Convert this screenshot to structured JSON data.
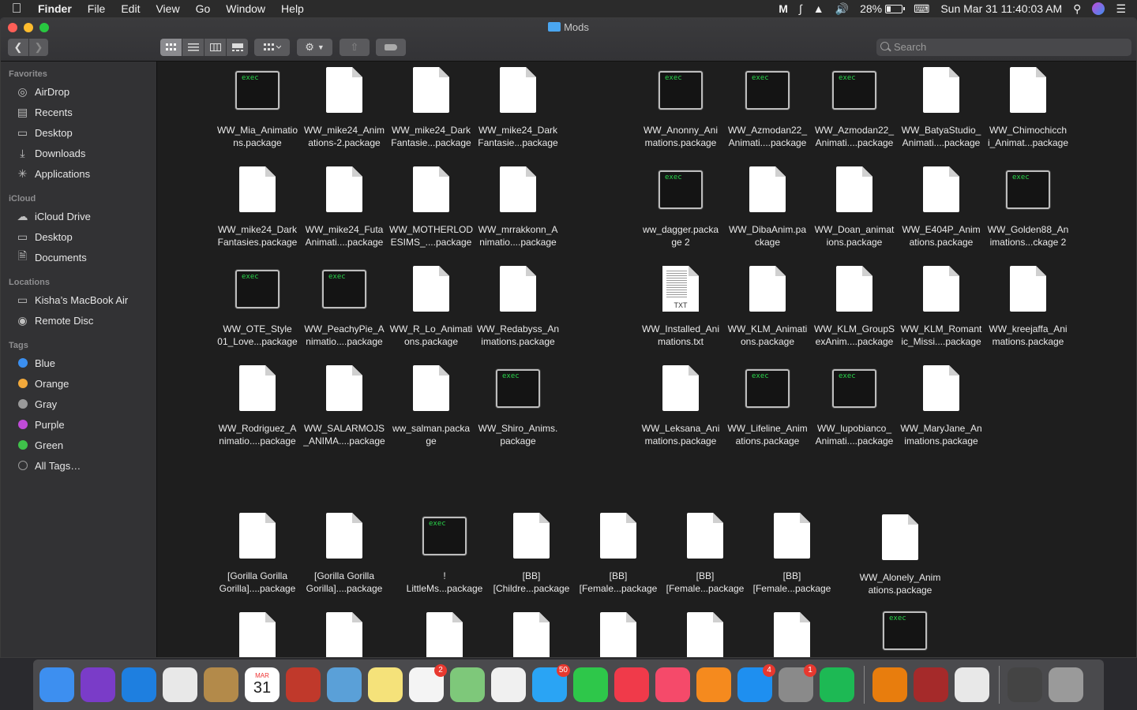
{
  "menubar": {
    "app_name": "Finder",
    "menus": [
      "File",
      "Edit",
      "View",
      "Go",
      "Window",
      "Help"
    ],
    "battery": "28%",
    "datetime": "Sun Mar 31  11:40:03 AM"
  },
  "window": {
    "title": "Mods",
    "search_placeholder": "Search"
  },
  "sidebar": {
    "favorites_header": "Favorites",
    "favorites": [
      "AirDrop",
      "Recents",
      "Desktop",
      "Downloads",
      "Applications"
    ],
    "icloud_header": "iCloud",
    "icloud": [
      "iCloud Drive",
      "Desktop",
      "Documents"
    ],
    "locations_header": "Locations",
    "locations": [
      "Kisha’s MacBook Air",
      "Remote Disc"
    ],
    "tags_header": "Tags",
    "tags": [
      {
        "label": "Blue",
        "color": "#3b8ff0"
      },
      {
        "label": "Orange",
        "color": "#f2a93b"
      },
      {
        "label": "Gray",
        "color": "#9a9a9a"
      },
      {
        "label": "Purple",
        "color": "#c04bd8"
      },
      {
        "label": "Green",
        "color": "#3fc24a"
      },
      {
        "label": "All Tags…",
        "color": ""
      }
    ]
  },
  "files": [
    {
      "name": "WW_Mia_Animatio\nns.package",
      "kind": "exec"
    },
    {
      "name": "WW_mike24_Anim\nations-2.package",
      "kind": "doc"
    },
    {
      "name": "WW_mike24_Dark\nFantasie...package",
      "kind": "doc"
    },
    {
      "name": "WW_mike24_Dark\nFantasie...package",
      "kind": "doc"
    },
    {
      "name": "WW_Anonny_Ani\nmations.package",
      "kind": "exec"
    },
    {
      "name": "WW_Azmodan22_\nAnimati....package",
      "kind": "exec"
    },
    {
      "name": "WW_Azmodan22_\nAnimati....package",
      "kind": "exec"
    },
    {
      "name": "WW_BatyaStudio_\nAnimati....package",
      "kind": "doc"
    },
    {
      "name": "WW_Chimochicch\ni_Animat...package",
      "kind": "doc"
    },
    {
      "name": "WW_mike24_Dark\nFantasies.package",
      "kind": "doc"
    },
    {
      "name": "WW_mike24_Futa\nAnimati....package",
      "kind": "doc"
    },
    {
      "name": "WW_MOTHERLOD\nESIMS_....package",
      "kind": "doc"
    },
    {
      "name": "WW_mrrakkonn_A\nnimatio....package",
      "kind": "doc"
    },
    {
      "name": "ww_dagger.packa\nge 2",
      "kind": "exec"
    },
    {
      "name": "WW_DibaAnim.pa\nckage",
      "kind": "doc"
    },
    {
      "name": "WW_Doan_animat\nions.package",
      "kind": "doc"
    },
    {
      "name": "WW_E404P_Anim\nations.package",
      "kind": "doc"
    },
    {
      "name": "WW_Golden88_An\nimations...ckage 2",
      "kind": "exec"
    },
    {
      "name": "WW_OTE_Style\n01_Love...package",
      "kind": "exec"
    },
    {
      "name": "WW_PeachyPie_A\nnimatio....package",
      "kind": "exec"
    },
    {
      "name": "WW_R_Lo_Animati\nons.package",
      "kind": "doc"
    },
    {
      "name": "WW_Redabyss_An\nimations.package",
      "kind": "doc"
    },
    {
      "name": "WW_Installed_Ani\nmations.txt",
      "kind": "txt"
    },
    {
      "name": "WW_KLM_Animati\nons.package",
      "kind": "doc"
    },
    {
      "name": "WW_KLM_GroupS\nexAnim....package",
      "kind": "doc"
    },
    {
      "name": "WW_KLM_Romant\nic_Missi....package",
      "kind": "doc"
    },
    {
      "name": "WW_kreejaffa_Ani\nmations.package",
      "kind": "doc"
    },
    {
      "name": "WW_Rodriguez_A\nnimatio....package",
      "kind": "doc"
    },
    {
      "name": "WW_SALARMOJS\n_ANIMA....package",
      "kind": "doc"
    },
    {
      "name": "ww_salman.packa\nge",
      "kind": "doc"
    },
    {
      "name": "WW_Shiro_Anims.\npackage",
      "kind": "exec"
    },
    {
      "name": "WW_Leksana_Ani\nmations.package",
      "kind": "doc"
    },
    {
      "name": "WW_Lifeline_Anim\nations.package",
      "kind": "exec"
    },
    {
      "name": "WW_lupobianco_\nAnimati....package",
      "kind": "exec"
    },
    {
      "name": "WW_MaryJane_An\nimations.package",
      "kind": "doc"
    },
    {
      "name": "[Gorilla Gorilla\nGorilla]....package",
      "kind": "doc"
    },
    {
      "name": "[Gorilla Gorilla\nGorilla]....package",
      "kind": "doc"
    },
    {
      "name": "!\nLittleMs...package",
      "kind": "exec"
    },
    {
      "name": "[BB]\n[Childre...package",
      "kind": "doc"
    },
    {
      "name": "[BB]\n[Female...package",
      "kind": "doc"
    },
    {
      "name": "[BB]\n[Female...package",
      "kind": "doc"
    },
    {
      "name": "[BB]\n[Female...package",
      "kind": "doc"
    },
    {
      "name": "WW_Alonely_Anim\nations.package",
      "kind": "doc"
    },
    {
      "name": "",
      "kind": "doc"
    },
    {
      "name": "",
      "kind": "doc"
    },
    {
      "name": "",
      "kind": "doc"
    },
    {
      "name": "",
      "kind": "doc"
    },
    {
      "name": "",
      "kind": "doc"
    },
    {
      "name": "",
      "kind": "doc"
    },
    {
      "name": "",
      "kind": "doc"
    },
    {
      "name": "",
      "kind": "exec"
    }
  ],
  "exec_label": "exec",
  "txt_label": "TXT",
  "calendar": {
    "month": "MAR",
    "day": "31"
  },
  "dock": [
    {
      "name": "finder",
      "color": "#3d8ff0",
      "badge": ""
    },
    {
      "name": "siri",
      "color": "#7a3cc8",
      "badge": ""
    },
    {
      "name": "safari",
      "color": "#1e7fe0",
      "badge": ""
    },
    {
      "name": "chrome",
      "color": "#e8e8e8",
      "badge": ""
    },
    {
      "name": "contacts",
      "color": "#b38a4a",
      "badge": ""
    },
    {
      "name": "calendar",
      "color": "#ffffff",
      "badge": ""
    },
    {
      "name": "photo-booth",
      "color": "#c0392b",
      "badge": ""
    },
    {
      "name": "preview",
      "color": "#5aa0d8",
      "badge": ""
    },
    {
      "name": "notes",
      "color": "#f5e27a",
      "badge": ""
    },
    {
      "name": "reminders",
      "color": "#f4f4f4",
      "badge": "2"
    },
    {
      "name": "maps",
      "color": "#7ec87a",
      "badge": ""
    },
    {
      "name": "photos",
      "color": "#f0f0f0",
      "badge": ""
    },
    {
      "name": "messages",
      "color": "#2aa4f4",
      "badge": "50"
    },
    {
      "name": "facetime",
      "color": "#2ec74a",
      "badge": ""
    },
    {
      "name": "news",
      "color": "#f03a4a",
      "badge": ""
    },
    {
      "name": "music",
      "color": "#f54a6a",
      "badge": ""
    },
    {
      "name": "books",
      "color": "#f58a1e",
      "badge": ""
    },
    {
      "name": "app-store",
      "color": "#1e8ff0",
      "badge": "4"
    },
    {
      "name": "system-preferences",
      "color": "#8a8a8a",
      "badge": "1"
    },
    {
      "name": "spotify",
      "color": "#1db954",
      "badge": ""
    },
    {
      "name": "blender",
      "color": "#e87d0d",
      "badge": ""
    },
    {
      "name": "dictionary",
      "color": "#a52a2a",
      "badge": ""
    },
    {
      "name": "textedit",
      "color": "#e8e8e8",
      "badge": ""
    },
    {
      "name": "downloads-stack",
      "color": "#444",
      "badge": ""
    },
    {
      "name": "trash",
      "color": "#9a9a9a",
      "badge": ""
    }
  ]
}
